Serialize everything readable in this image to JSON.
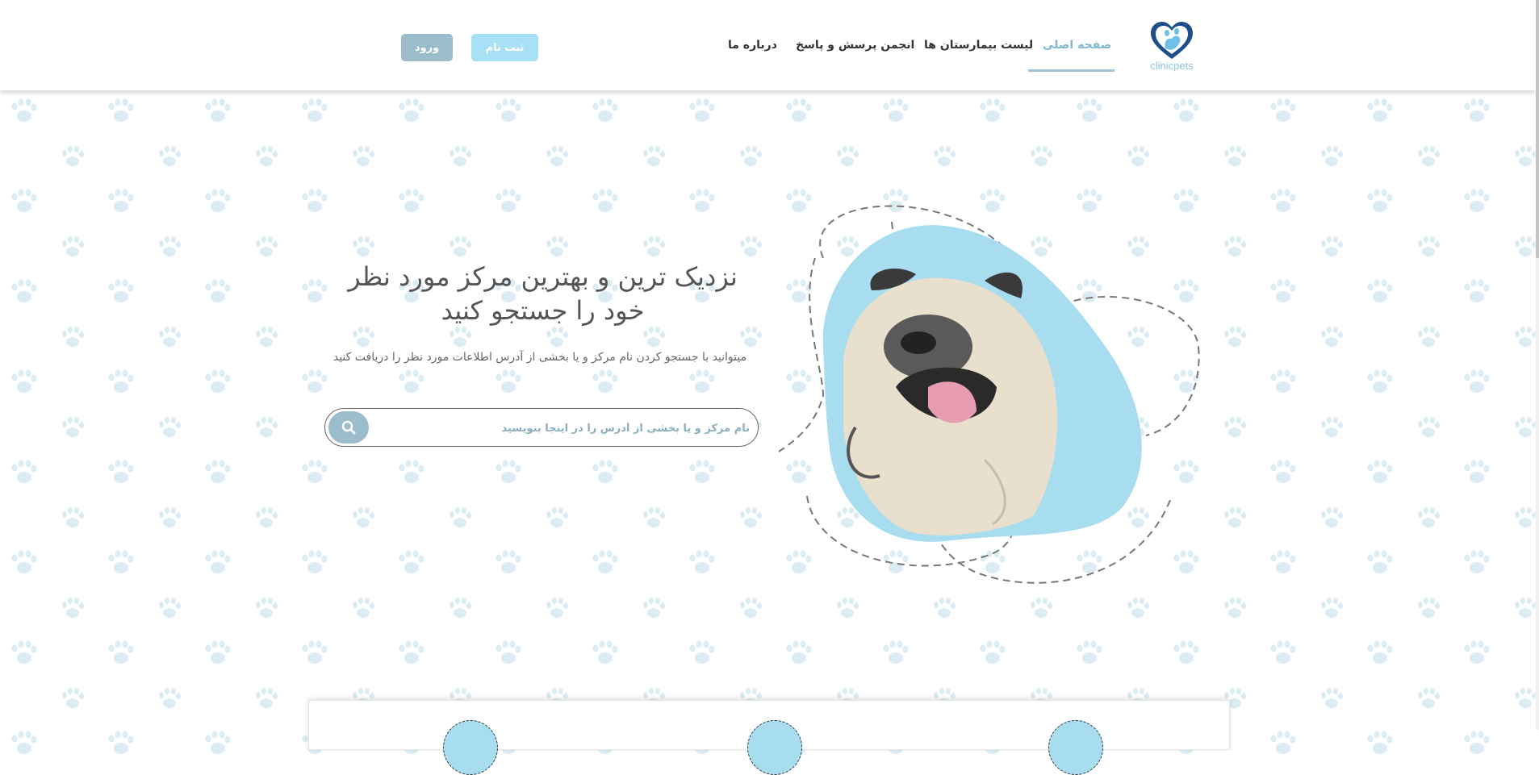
{
  "header": {
    "logo_text": "clinicpets",
    "nav": [
      {
        "label": "صفحه اصلی",
        "active": true
      },
      {
        "label": "لیست بیمارستان ها",
        "active": false
      },
      {
        "label": "انجمن پرسش و پاسخ",
        "active": false
      },
      {
        "label": "درباره ما",
        "active": false
      }
    ],
    "register_label": "ثبت نام",
    "login_label": "ورود"
  },
  "hero": {
    "title_line1": "نزدیک ترین و بهترین مرکز مورد نظر",
    "title_line2": "خود را جستجو کنید",
    "subtitle": "میتوانید با جستجو کردن نام مرکز و یا بخشی از آدرس اطلاعات مورد نظر را دریافت کنید",
    "search": {
      "placeholder": "نام مرکز و یا بخشی از آدرس را در اینجا بنویسید",
      "value": "",
      "icon": "search-icon"
    },
    "image": "pug-dog-image"
  },
  "colors": {
    "accent": "#9bbccb",
    "light_blue": "#a8e0f5",
    "active_nav": "#7fb7cf",
    "blob": "#a8dcef"
  }
}
